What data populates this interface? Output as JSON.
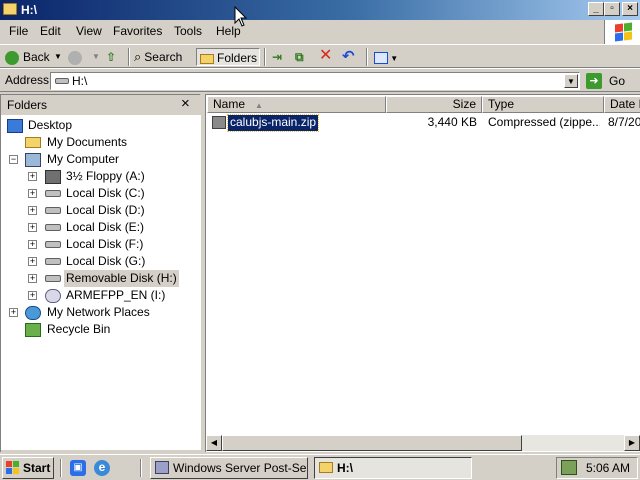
{
  "window": {
    "title": "H:\\"
  },
  "menu": [
    "File",
    "Edit",
    "View",
    "Favorites",
    "Tools",
    "Help"
  ],
  "toolbar": {
    "back": "Back",
    "search": "Search",
    "folders": "Folders"
  },
  "address": {
    "label": "Address",
    "value": "H:\\",
    "go": "Go"
  },
  "folders_pane": {
    "title": "Folders",
    "close": "×",
    "items": [
      {
        "label": "Desktop",
        "level": 0,
        "expander": "",
        "icon": "desktop-icon"
      },
      {
        "label": "My Documents",
        "level": 1,
        "expander": "",
        "icon": "folder-icon"
      },
      {
        "label": "My Computer",
        "level": 1,
        "expander": "−",
        "icon": "computer-icon"
      },
      {
        "label": "3½ Floppy (A:)",
        "level": 2,
        "expander": "+",
        "icon": "floppy-icon"
      },
      {
        "label": "Local Disk (C:)",
        "level": 2,
        "expander": "+",
        "icon": "drive-icon"
      },
      {
        "label": "Local Disk (D:)",
        "level": 2,
        "expander": "+",
        "icon": "drive-icon"
      },
      {
        "label": "Local Disk (E:)",
        "level": 2,
        "expander": "+",
        "icon": "drive-icon"
      },
      {
        "label": "Local Disk (F:)",
        "level": 2,
        "expander": "+",
        "icon": "drive-icon"
      },
      {
        "label": "Local Disk (G:)",
        "level": 2,
        "expander": "+",
        "icon": "drive-icon"
      },
      {
        "label": "Removable Disk (H:)",
        "level": 2,
        "expander": "+",
        "icon": "drive-icon",
        "selected": true
      },
      {
        "label": "ARMEFPP_EN (I:)",
        "level": 2,
        "expander": "+",
        "icon": "cd-icon"
      },
      {
        "label": "My Network Places",
        "level": 1,
        "expander": "+",
        "icon": "network-icon"
      },
      {
        "label": "Recycle Bin",
        "level": 1,
        "expander": "",
        "icon": "recycle-icon"
      }
    ]
  },
  "file_list": {
    "columns": [
      "Name",
      "Size",
      "Type",
      "Date M"
    ],
    "rows": [
      {
        "name": "calubjs-main.zip",
        "size": "3,440 KB",
        "type": "Compressed (zippe...",
        "date": "8/7/20"
      }
    ]
  },
  "taskbar": {
    "start": "Start",
    "tasks": [
      "Windows Server Post-Se...",
      "H:\\"
    ],
    "clock": "5:06 AM"
  },
  "colors": {
    "title_start": "#0a246a",
    "title_end": "#a6caf0",
    "selection": "#0a246a",
    "face": "#d4d0c8"
  }
}
